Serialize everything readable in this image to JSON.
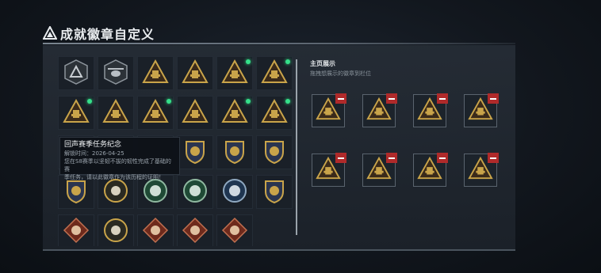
{
  "page": {
    "title": "成就徽章自定义"
  },
  "tooltip": {
    "title": "回声赛季任务纪念",
    "date_line": "解锁时间：2026-04-25",
    "desc_line1": "您在S8赛季以坚韧不拔的韧性完成了基础的赛",
    "desc_line2": "季任务，请以此徽章作为该历程的证明！"
  },
  "showcase": {
    "title": "主页展示",
    "subtitle": "拖拽想展示的徽章到栏位"
  },
  "colors": {
    "gold": "#c9a44a",
    "dark_red": "#6e2a1c",
    "remove_red": "#b02a2a",
    "new_dot": "#35e08a"
  },
  "badge_grid": [
    {
      "icon": "grey-triangle-badge-icon",
      "new": false
    },
    {
      "icon": "helicopter-badge-icon",
      "new": false
    },
    {
      "icon": "backpack-triangle-badge-icon",
      "new": false
    },
    {
      "icon": "vehicle-triangle-badge-icon",
      "new": false
    },
    {
      "icon": "backpack-triangle-badge-icon",
      "new": true
    },
    {
      "icon": "radio-triangle-badge-icon",
      "new": true
    },
    {
      "icon": "turret-triangle-badge-icon",
      "new": true
    },
    {
      "icon": "helmet-triangle-badge-icon",
      "new": false
    },
    {
      "icon": "rifle-triangle-badge-icon",
      "new": true
    },
    {
      "icon": "knife-triangle-badge-icon",
      "new": false
    },
    {
      "icon": "armor-triangle-badge-icon",
      "new": true
    },
    {
      "icon": "soldier-triangle-badge-icon",
      "new": true
    },
    {
      "icon": "hidden",
      "new": false
    },
    {
      "icon": "hidden",
      "new": false
    },
    {
      "icon": "hidden",
      "new": false
    },
    {
      "icon": "cross-shield-badge-icon",
      "new": false
    },
    {
      "icon": "wing-shield-badge-icon",
      "new": false
    },
    {
      "icon": "star-shield-badge-icon",
      "new": false
    },
    {
      "icon": "wolf-shield-badge-icon",
      "new": false
    },
    {
      "icon": "skull-circle-badge-icon",
      "new": false
    },
    {
      "icon": "beast-green-badge-icon",
      "new": false
    },
    {
      "icon": "eagle-green-badge-icon",
      "new": false
    },
    {
      "icon": "eagle-blue-badge-icon",
      "new": false
    },
    {
      "icon": "stripe-shield-badge-icon",
      "new": false
    },
    {
      "icon": "wolf-red-diamond-badge-icon",
      "new": false
    },
    {
      "icon": "shark-circle-badge-icon",
      "new": false
    },
    {
      "icon": "raptor-red-diamond-badge-icon",
      "new": false
    },
    {
      "icon": "claw-red-diamond-badge-icon",
      "new": false
    },
    {
      "icon": "runner-red-diamond-badge-icon",
      "new": false
    }
  ],
  "showcase_slots": [
    {
      "icon": "backpack-triangle-badge-icon"
    },
    {
      "icon": "vehicle-triangle-badge-icon"
    },
    {
      "icon": "turret-triangle-badge-icon"
    },
    {
      "icon": "soldier-triangle-badge-icon"
    },
    {
      "icon": "soldier-triangle-badge-icon"
    },
    {
      "icon": "armor-triangle-badge-icon"
    },
    {
      "icon": "rifle-triangle-badge-icon"
    },
    {
      "icon": "alert-triangle-badge-icon"
    }
  ]
}
